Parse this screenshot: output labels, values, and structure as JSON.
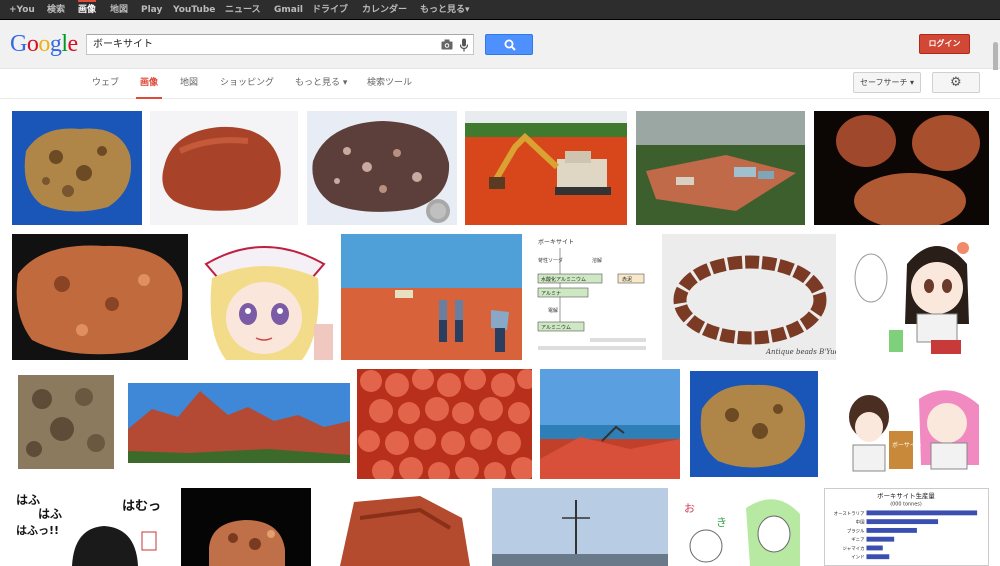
{
  "topbar": {
    "items": [
      "+You",
      "検索",
      "画像",
      "地図",
      "Play",
      "YouTube",
      "ニュース",
      "Gmail",
      "ドライブ",
      "カレンダー",
      "もっと見る▾"
    ]
  },
  "logo": {
    "letters": [
      "G",
      "o",
      "o",
      "g",
      "l",
      "e"
    ]
  },
  "search": {
    "query": "ボーキサイト"
  },
  "login": {
    "label": "ログイン"
  },
  "nav": {
    "tabs": [
      "ウェブ",
      "画像",
      "地図",
      "ショッピング",
      "もっと見る ▾",
      "検索ツール"
    ],
    "safesearch": "セーフサーチ ▾"
  },
  "thumbs": {
    "diagram_title": "ボーキサイト",
    "diagram_lines": [
      "苛性ソーダ",
      "溶解",
      "水酸化アルミニウム",
      "赤泥",
      "アルミナ",
      "電解",
      "アルミニウム"
    ],
    "beads_caption": "Antique beads B'Yue",
    "chart_title": "ボーキサイト生産量",
    "chart_subtitle": "(000 tonnes)",
    "chart_labels": [
      "オーストラリア",
      "中国",
      "ブラジル",
      "ギニア",
      "ジャマイカ",
      "インド"
    ],
    "manga_text": [
      "はふ",
      "はふ",
      "はふっ!!",
      "はむっ"
    ],
    "bauxite_tag": "ボーサイト"
  },
  "chart_data": {
    "type": "bar",
    "title": "ボーキサイト生産量",
    "subtitle": "(000 tonnes)",
    "categories": [
      "オーストラリア",
      "中国",
      "ブラジル",
      "ギニア",
      "ジャマイカ",
      "インド"
    ],
    "values": [
      68000,
      44000,
      31000,
      17000,
      10000,
      14000
    ]
  },
  "colors": {
    "logo": [
      "#3369e8",
      "#d50f25",
      "#eeb211",
      "#3369e8",
      "#009925",
      "#d50f25"
    ],
    "accent": "#dd4b39",
    "search_button": "#4d90fe"
  }
}
